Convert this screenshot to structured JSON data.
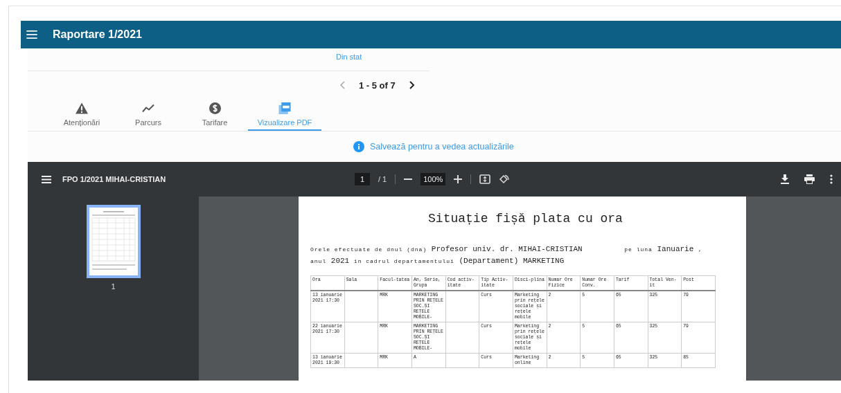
{
  "app_bar": {
    "title": "Raportare 1/2021"
  },
  "source_link": "Din stat",
  "pagination": {
    "range": "1 - 5 of 7"
  },
  "tabs": [
    {
      "label": "Atenționări",
      "kind": "warning",
      "selected": false
    },
    {
      "label": "Parcurs",
      "kind": "trend",
      "selected": false
    },
    {
      "label": "Tarifare",
      "kind": "dollar",
      "selected": false
    },
    {
      "label": "Vizualizare PDF",
      "kind": "pdf",
      "selected": true
    }
  ],
  "notice": "Salvează pentru a vedea actualizările",
  "pdf_viewer": {
    "file_title": "FPO 1/2021 MIHAI-CRISTIAN",
    "page_current": "1",
    "page_total": "/ 1",
    "zoom": "100%",
    "thumbnail_label": "1",
    "document": {
      "title": "Situație fișă plata cu ora",
      "intro": [
        {
          "kind": "label",
          "text": "Orele efectuate de dnul (dna)"
        },
        {
          "kind": "value",
          "text": "Profesor univ. dr. MIHAI-CRISTIAN"
        },
        {
          "kind": "gap",
          "text": "pe luna"
        },
        {
          "kind": "value",
          "text": "Ianuarie"
        },
        {
          "kind": "label",
          "text": ","
        },
        {
          "kind": "break",
          "text": "anul"
        },
        {
          "kind": "value",
          "text": "2021"
        },
        {
          "kind": "label",
          "text": "in cadrul departamentului"
        },
        {
          "kind": "value",
          "text": "(Departament) MARKETING"
        }
      ],
      "columns": [
        "Ora",
        "Sala",
        "Facul-tatea",
        "An, Serie, Grupa",
        "Cod activ-itate",
        "Tip Activ-itate",
        "Disci-plina",
        "Numar Ore Fizice",
        "Numar Ore Conv.",
        "Tarif",
        "Total Ven-it",
        "Post"
      ],
      "rows": [
        [
          "13 ianuarie 2021 17:30",
          "",
          "MRK",
          "MARKETING PRIN REȚELE SOC.ȘI REȚELE MOBILE-",
          "",
          "Curs",
          "Marketing prin rețele sociale și rețele mobile",
          "2",
          "5",
          "65",
          "325",
          "79"
        ],
        [
          "22 ianuarie 2021 17:30",
          "",
          "MRK",
          "MARKETING PRIN REȚELE SOC.ȘI REȚELE MOBILE-",
          "",
          "Curs",
          "Marketing prin rețele sociale și rețele mobile",
          "2",
          "5",
          "65",
          "325",
          "79"
        ],
        [
          "13 ianuarie 2021 19:30",
          "",
          "MRK",
          "A",
          "",
          "Curs",
          "Marketing online",
          "2",
          "5",
          "65",
          "325",
          "85"
        ]
      ]
    }
  }
}
